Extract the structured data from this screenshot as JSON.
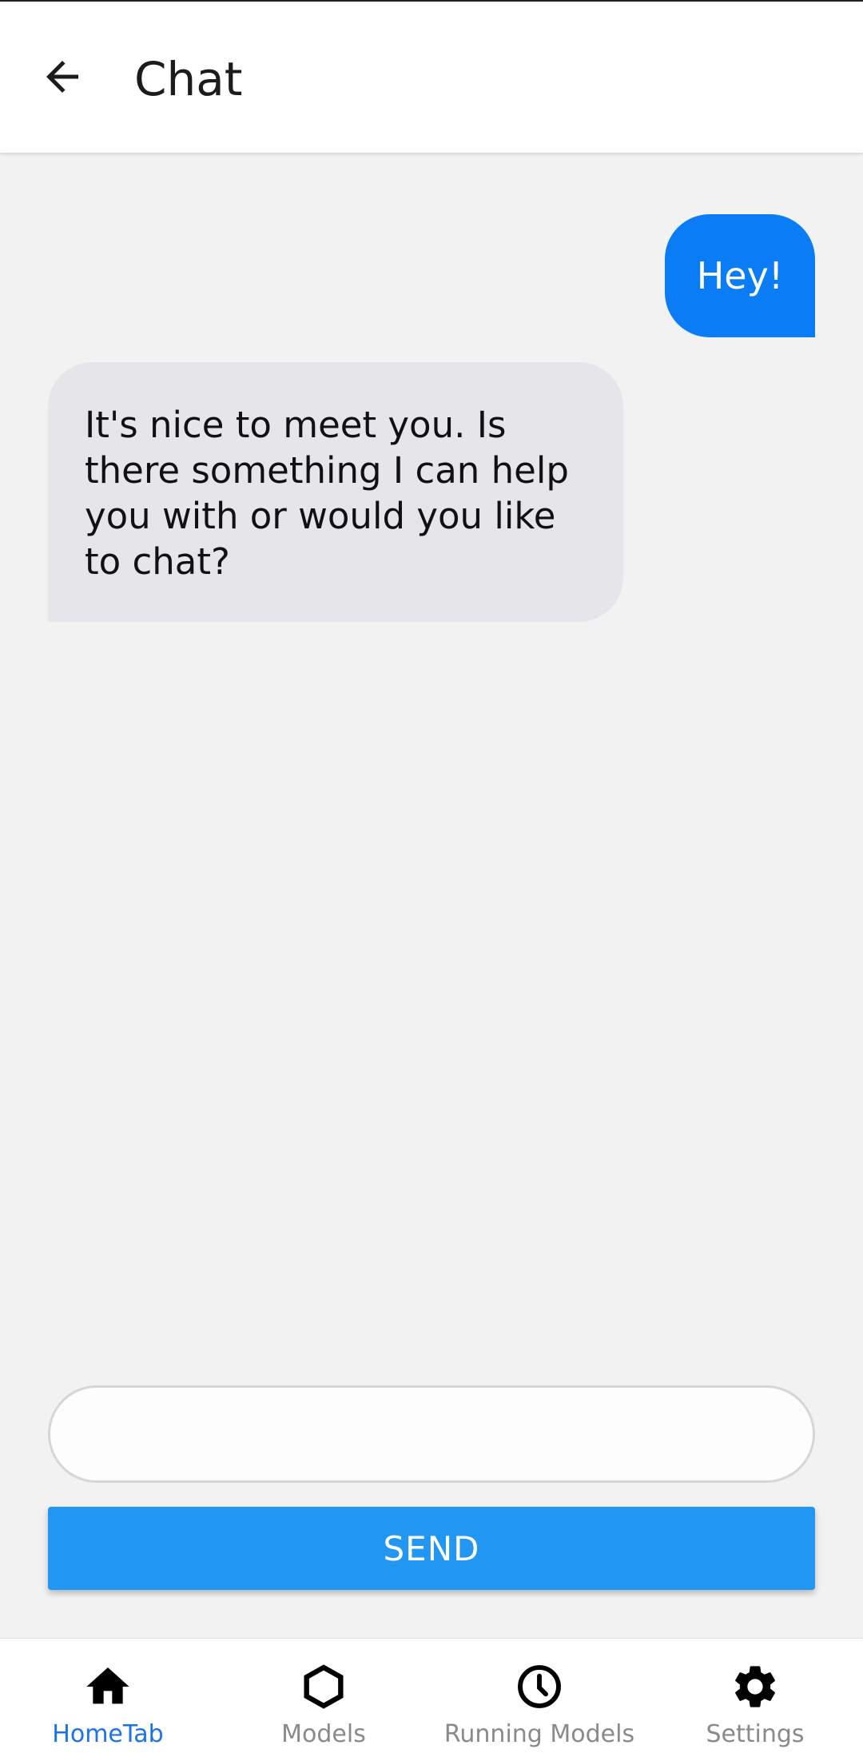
{
  "app_bar": {
    "title": "Chat",
    "back_icon": "arrow-left-icon"
  },
  "messages": [
    {
      "sender": "user",
      "text": "Hey!"
    },
    {
      "sender": "bot",
      "text": "It's nice to meet you. Is there something I can help you with or would you like to chat?"
    }
  ],
  "composer": {
    "input_value": "",
    "input_placeholder": "",
    "send_label": "SEND"
  },
  "bottom_nav": {
    "items": [
      {
        "label": "HomeTab",
        "icon": "home-icon",
        "active": true
      },
      {
        "label": "Models",
        "icon": "hexagon-icon",
        "active": false
      },
      {
        "label": "Running Models",
        "icon": "clock-icon",
        "active": false
      },
      {
        "label": "Settings",
        "icon": "gear-icon",
        "active": false
      }
    ]
  },
  "colors": {
    "user_bubble": "#0a7cf6",
    "bot_bubble": "#e5e5ea",
    "send_button": "#2196f3",
    "active_tab": "#1a73e8",
    "inactive_tab": "#8a8a8a"
  }
}
